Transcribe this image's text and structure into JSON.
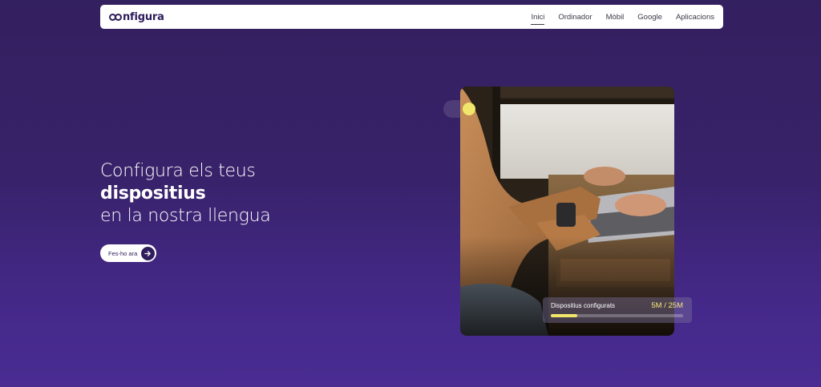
{
  "brand": {
    "logo_text": "nfigura"
  },
  "nav": {
    "items": [
      {
        "label": "Inici",
        "active": true
      },
      {
        "label": "Ordinador",
        "active": false
      },
      {
        "label": "Mòbil",
        "active": false
      },
      {
        "label": "Google",
        "active": false
      },
      {
        "label": "Aplicacions",
        "active": false
      }
    ]
  },
  "hero": {
    "line1": "Configura els teus",
    "line2": "dispositius",
    "line3": "en la nostra llengua",
    "cta_label": "Fes-ho ara",
    "cta_icon": "arrow-right-icon"
  },
  "stats": {
    "label": "Dispositius configurats",
    "value": "5M / 25M",
    "progress": 0.2
  },
  "colors": {
    "accent": "#f2e56b",
    "brand": "#2f1d5c",
    "background": "#38226a"
  }
}
